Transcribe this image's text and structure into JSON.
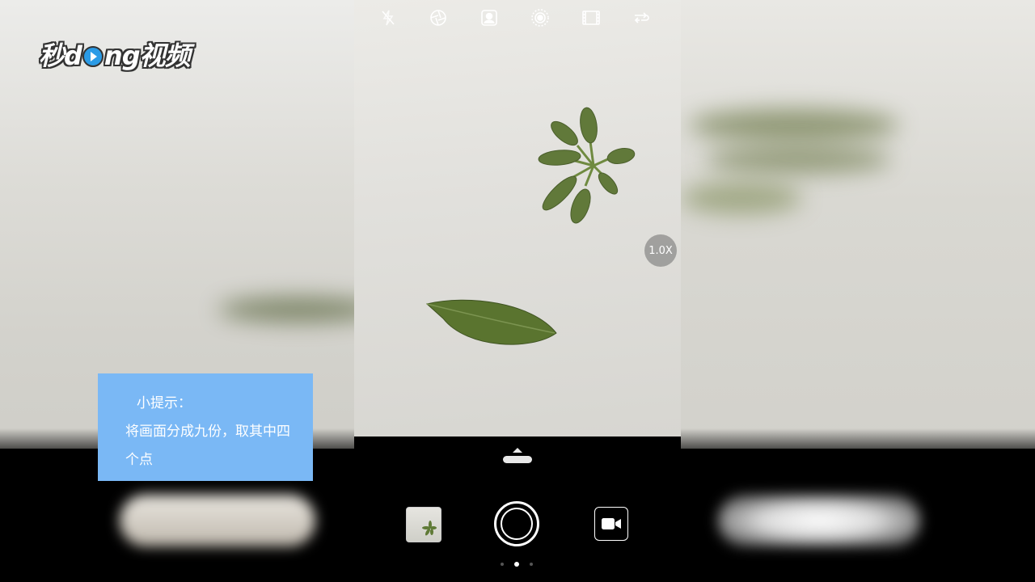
{
  "watermark": {
    "prefix": "秒d",
    "suffix": "ng视频"
  },
  "tip": {
    "title": "小提示：",
    "body": "将画面分成九份，取其中四个点"
  },
  "camera": {
    "top_icons": [
      "flash-off-icon",
      "aperture-icon",
      "portrait-icon",
      "hdr-icon",
      "filter-icon",
      "switch-camera-icon"
    ],
    "zoom_level": "1.0X",
    "mode_dots": 3,
    "active_mode_index": 1
  },
  "colors": {
    "tip_background": "#7ab8f5",
    "leaf_green": "#5f7a36"
  }
}
